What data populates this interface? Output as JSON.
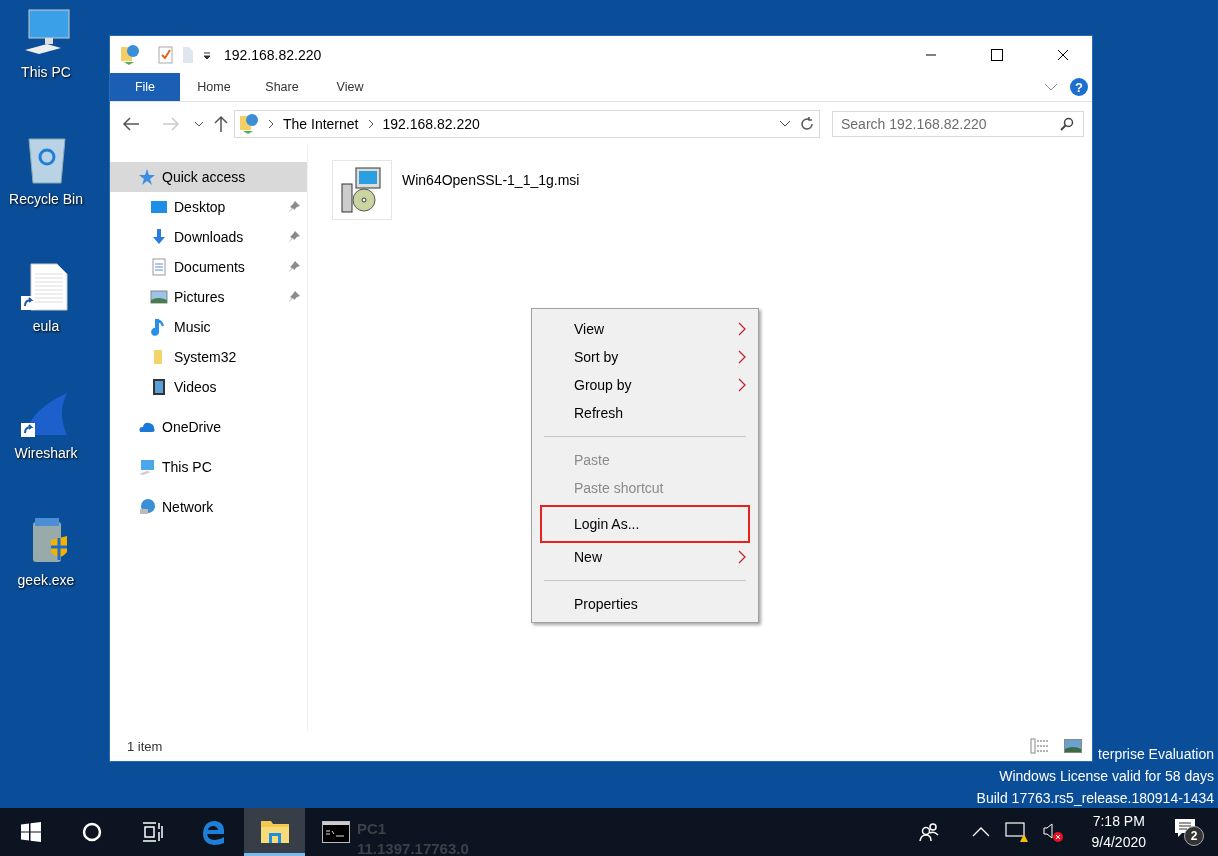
{
  "desktop_icons": [
    {
      "label": "This PC",
      "kind": "pc",
      "shortcut": false
    },
    {
      "label": "Recycle Bin",
      "kind": "recycle",
      "shortcut": false
    },
    {
      "label": "eula",
      "kind": "doc",
      "shortcut": true
    },
    {
      "label": "Wireshark",
      "kind": "shark",
      "shortcut": true
    },
    {
      "label": "geek.exe",
      "kind": "exe",
      "shortcut": false
    }
  ],
  "window": {
    "title": "192.168.82.220",
    "ribbon_tabs": [
      {
        "label": "File",
        "selected": true
      },
      {
        "label": "Home",
        "selected": false
      },
      {
        "label": "Share",
        "selected": false
      },
      {
        "label": "View",
        "selected": false
      }
    ],
    "help": "?",
    "address": {
      "path": [
        "The Internet",
        "192.168.82.220"
      ]
    },
    "search": {
      "placeholder": "Search 192.168.82.220"
    },
    "nav_items": [
      {
        "label": "Quick access",
        "kind": "star",
        "selected": true,
        "children": [
          {
            "label": "Desktop",
            "kind": "desktop",
            "pinned": true
          },
          {
            "label": "Downloads",
            "kind": "download",
            "pinned": true
          },
          {
            "label": "Documents",
            "kind": "documents",
            "pinned": true
          },
          {
            "label": "Pictures",
            "kind": "pictures",
            "pinned": true
          },
          {
            "label": "Music",
            "kind": "music",
            "pinned": false
          },
          {
            "label": "System32",
            "kind": "folder",
            "pinned": false
          },
          {
            "label": "Videos",
            "kind": "videos",
            "pinned": false
          }
        ]
      },
      {
        "label": "OneDrive",
        "kind": "cloud",
        "selected": false
      },
      {
        "label": "This PC",
        "kind": "pc",
        "selected": false
      },
      {
        "label": "Network",
        "kind": "network",
        "selected": false
      }
    ],
    "files": [
      {
        "name": "Win64OpenSSL-1_1_1g.msi"
      }
    ],
    "status": "1 item"
  },
  "context_menu": [
    {
      "kind": "item",
      "label": "View",
      "submenu": true,
      "disabled": false,
      "highlighted": false
    },
    {
      "kind": "item",
      "label": "Sort by",
      "submenu": true,
      "disabled": false,
      "highlighted": false
    },
    {
      "kind": "item",
      "label": "Group by",
      "submenu": true,
      "disabled": false,
      "highlighted": false
    },
    {
      "kind": "item",
      "label": "Refresh",
      "submenu": false,
      "disabled": false,
      "highlighted": false
    },
    {
      "kind": "separator"
    },
    {
      "kind": "item",
      "label": "Paste",
      "submenu": false,
      "disabled": true,
      "highlighted": false
    },
    {
      "kind": "item",
      "label": "Paste shortcut",
      "submenu": false,
      "disabled": true,
      "highlighted": false
    },
    {
      "kind": "item",
      "label": "Login As...",
      "submenu": false,
      "disabled": false,
      "highlighted": true
    },
    {
      "kind": "item",
      "label": "New",
      "submenu": true,
      "disabled": false,
      "highlighted": false
    },
    {
      "kind": "separator"
    },
    {
      "kind": "item",
      "label": "Properties",
      "submenu": false,
      "disabled": false,
      "highlighted": false
    }
  ],
  "watermark_lines": [
    "terprise Evaluation",
    "Windows License valid for 58 days",
    "Build 17763.rs5_release.180914-1434"
  ],
  "taskbar": {
    "background_info": [
      {
        "text": "PC1"
      },
      {
        "text": "11.1397.17763.0"
      }
    ],
    "time": "7:18 PM",
    "date": "9/4/2020",
    "notifications": "2"
  }
}
